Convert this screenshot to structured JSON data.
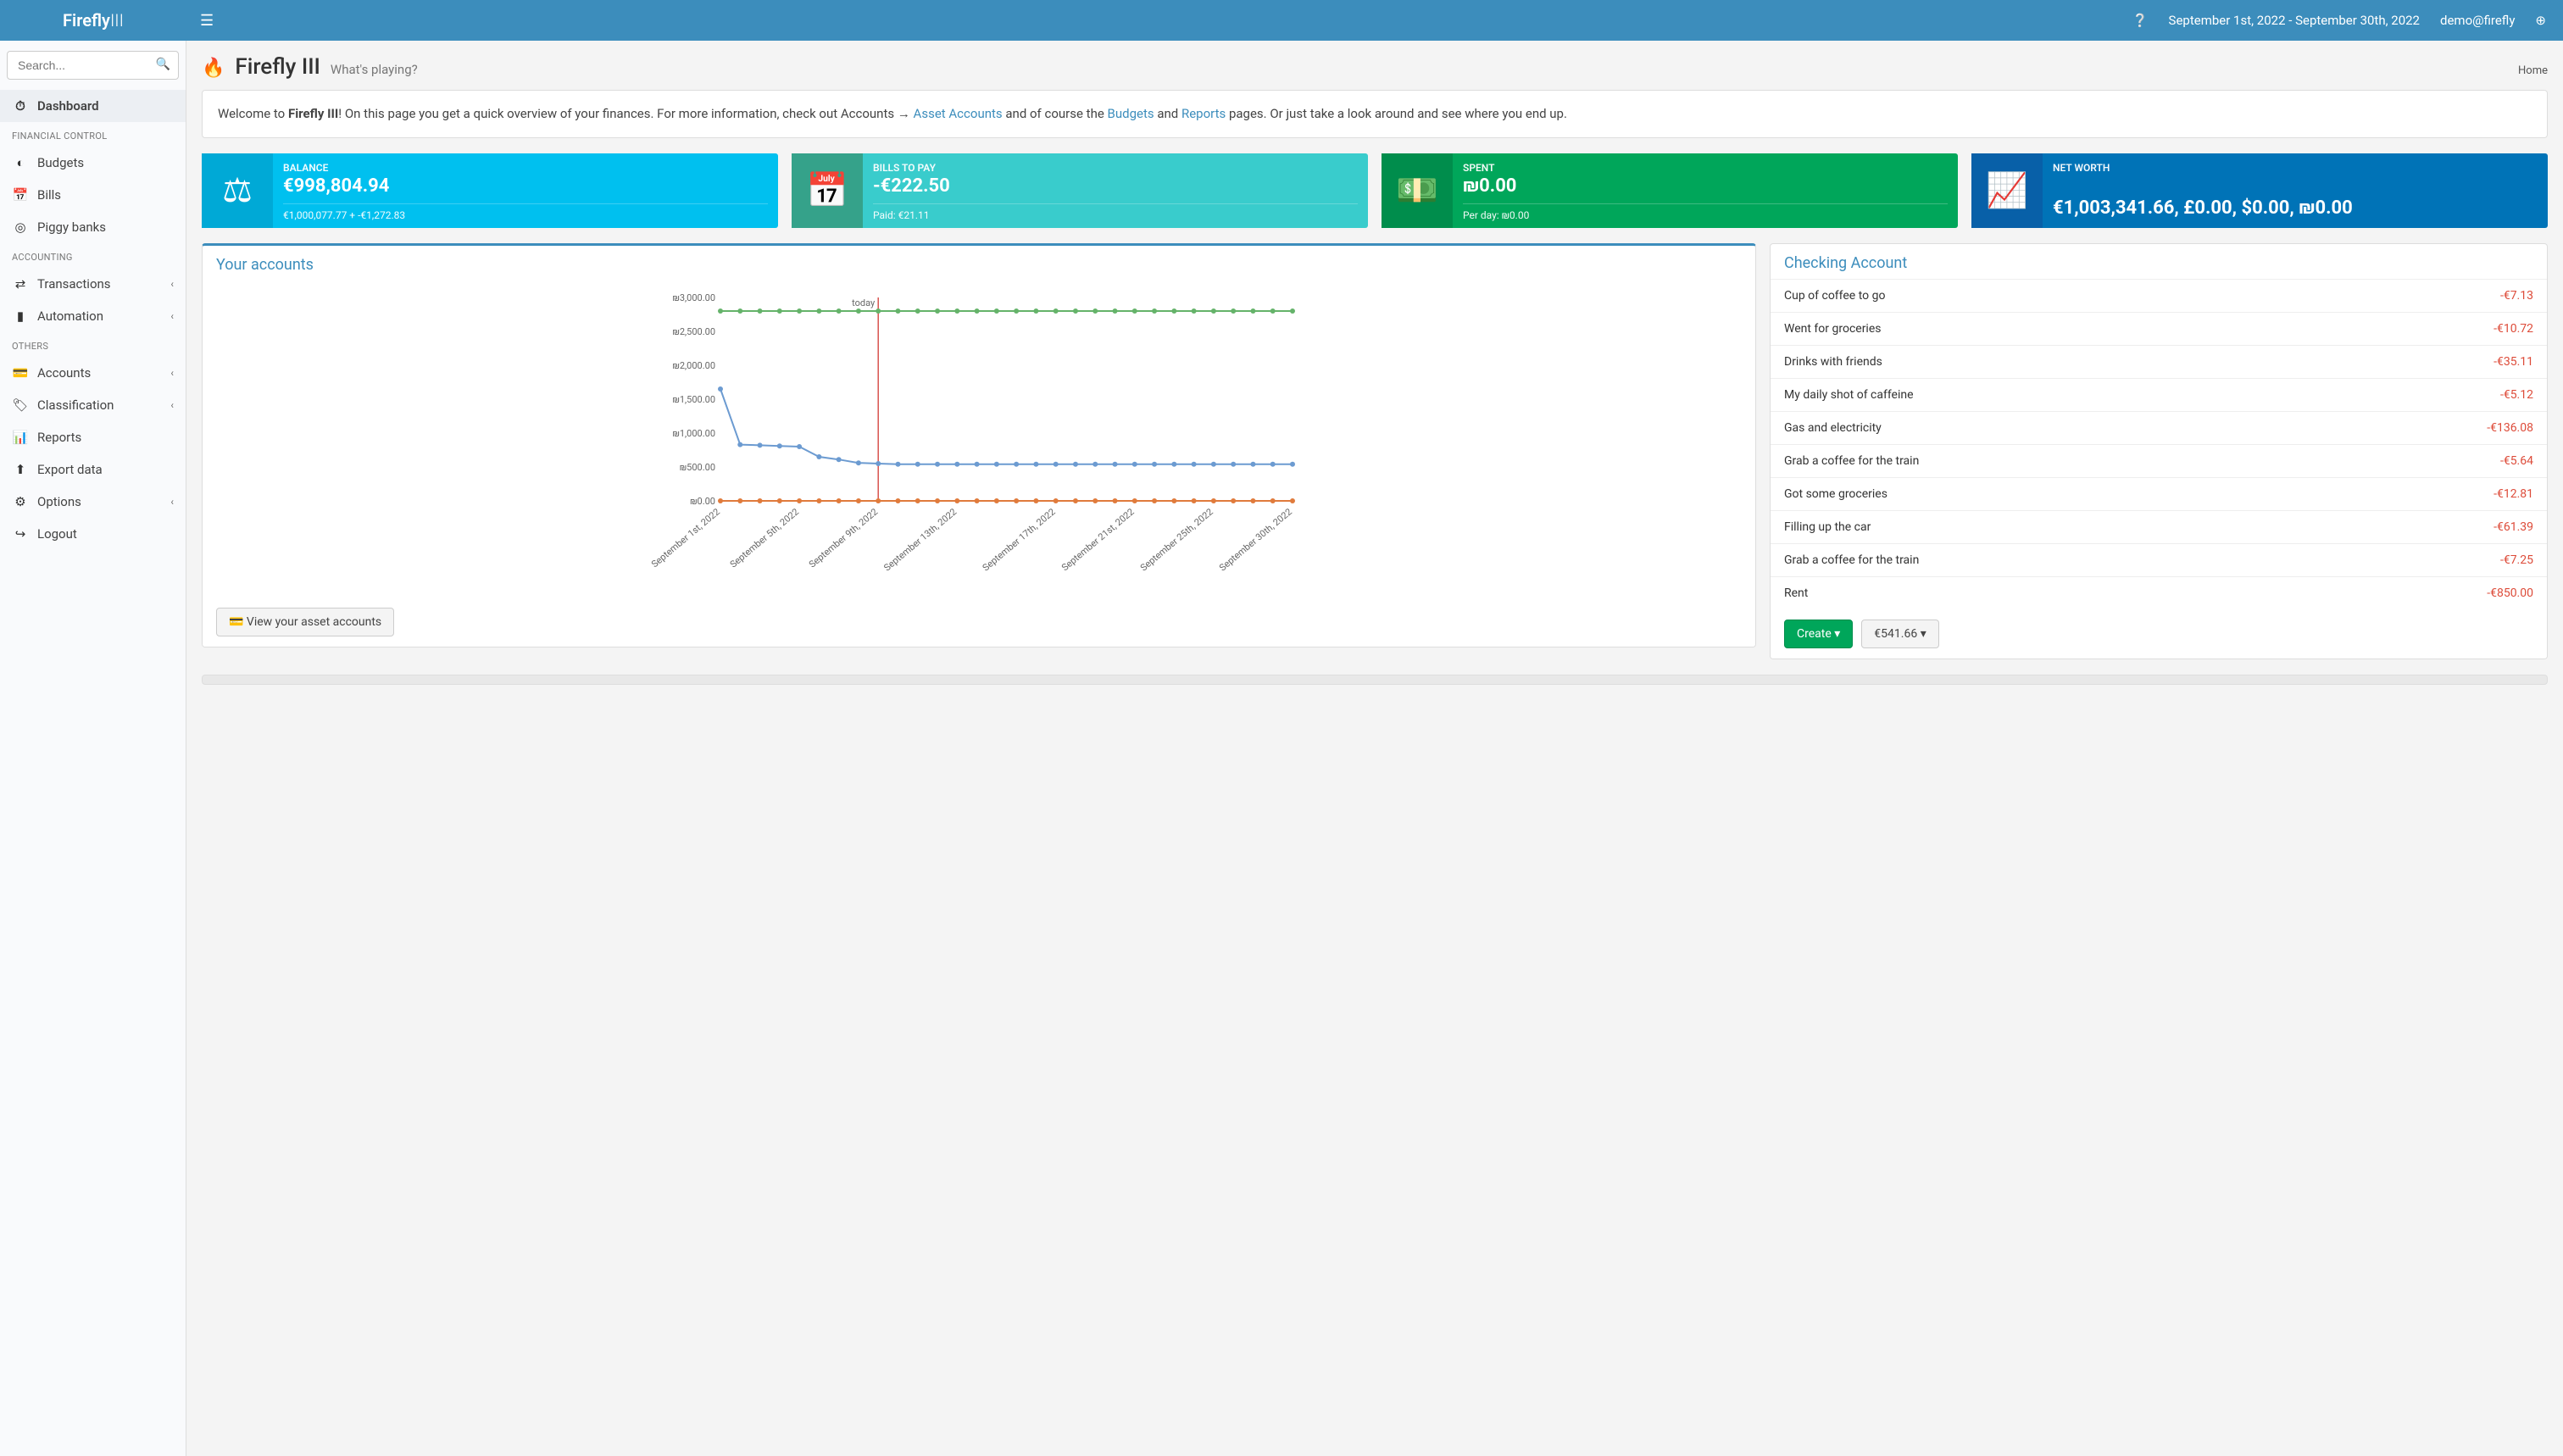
{
  "app": {
    "logo_bold": "Firefly",
    "logo_thin": "III"
  },
  "topbar": {
    "date_range": "September 1st, 2022 - September 30th, 2022",
    "user": "demo@firefly"
  },
  "search": {
    "placeholder": "Search..."
  },
  "sidebar": {
    "sections": [
      {
        "label": "",
        "items": [
          {
            "icon": "⏱",
            "label": "Dashboard",
            "active": true
          }
        ]
      },
      {
        "label": "FINANCIAL CONTROL",
        "items": [
          {
            "icon": "◐",
            "label": "Budgets"
          },
          {
            "icon": "📅",
            "label": "Bills"
          },
          {
            "icon": "◎",
            "label": "Piggy banks"
          }
        ]
      },
      {
        "label": "ACCOUNTING",
        "items": [
          {
            "icon": "⇄",
            "label": "Transactions",
            "expandable": true
          },
          {
            "icon": "▮",
            "label": "Automation",
            "expandable": true
          }
        ]
      },
      {
        "label": "OTHERS",
        "items": [
          {
            "icon": "💳",
            "label": "Accounts",
            "expandable": true
          },
          {
            "icon": "🏷",
            "label": "Classification",
            "expandable": true
          },
          {
            "icon": "📊",
            "label": "Reports"
          },
          {
            "icon": "⬆",
            "label": "Export data"
          },
          {
            "icon": "⚙",
            "label": "Options",
            "expandable": true
          },
          {
            "icon": "↪",
            "label": "Logout"
          }
        ]
      }
    ]
  },
  "page": {
    "title": "Firefly III",
    "subtitle": "What's playing?",
    "breadcrumb": "Home",
    "welcome": {
      "prefix": "Welcome to ",
      "bold": "Firefly III",
      "mid1": "! On this page you get a quick overview of your finances. For more information, check out Accounts → ",
      "link1": "Asset Accounts",
      "mid2": " and of course the ",
      "link2": "Budgets",
      "mid3": " and ",
      "link3": "Reports",
      "suffix": " pages. Or just take a look around and see where you end up."
    }
  },
  "info_boxes": {
    "balance": {
      "label": "BALANCE",
      "value": "€998,804.94",
      "foot": "€1,000,077.77 + -€1,272.83"
    },
    "bills": {
      "label": "BILLS TO PAY",
      "value": "-€222.50",
      "foot": "Paid: €21.11"
    },
    "spent": {
      "label": "SPENT",
      "value": "₪0.00",
      "foot": "Per day: ₪0.00"
    },
    "networth": {
      "label": "NET WORTH",
      "value": "€1,003,341.66, £0.00, $0.00, ₪0.00",
      "foot": ""
    }
  },
  "accounts_panel": {
    "title": "Your accounts",
    "view_btn": "View your asset accounts"
  },
  "checking_panel": {
    "title": "Checking Account",
    "transactions": [
      {
        "label": "Cup of coffee to go",
        "amount": "-€7.13"
      },
      {
        "label": "Went for groceries",
        "amount": "-€10.72"
      },
      {
        "label": "Drinks with friends",
        "amount": "-€35.11"
      },
      {
        "label": "My daily shot of caffeine",
        "amount": "-€5.12"
      },
      {
        "label": "Gas and electricity",
        "amount": "-€136.08"
      },
      {
        "label": "Grab a coffee for the train",
        "amount": "-€5.64"
      },
      {
        "label": "Got some groceries",
        "amount": "-€12.81"
      },
      {
        "label": "Filling up the car",
        "amount": "-€61.39"
      },
      {
        "label": "Grab a coffee for the train",
        "amount": "-€7.25"
      },
      {
        "label": "Rent",
        "amount": "-€850.00"
      }
    ],
    "create_btn": "Create",
    "balance_btn": "€541.66"
  },
  "chart_data": {
    "type": "line",
    "title": "Your accounts",
    "ylabel": "",
    "yticks": [
      "₪0.00",
      "₪500.00",
      "₪1,000.00",
      "₪1,500.00",
      "₪2,000.00",
      "₪2,500.00",
      "₪3,000.00"
    ],
    "ylim": [
      0,
      3000
    ],
    "xticks": [
      "September 1st, 2022",
      "September 5th, 2022",
      "September 9th, 2022",
      "September 13th, 2022",
      "September 17th, 2022",
      "September 21st, 2022",
      "September 25th, 2022",
      "September 30th, 2022"
    ],
    "today_index": 8,
    "today_label": "today",
    "x": [
      0,
      1,
      2,
      3,
      4,
      5,
      6,
      7,
      8,
      9,
      10,
      11,
      12,
      13,
      14,
      15,
      16,
      17,
      18,
      19,
      20,
      21,
      22,
      23,
      24,
      25,
      26,
      27,
      28,
      29
    ],
    "series": [
      {
        "name": "green",
        "color": "#65b36a",
        "values": [
          2800,
          2800,
          2800,
          2800,
          2800,
          2800,
          2800,
          2800,
          2800,
          2800,
          2800,
          2800,
          2800,
          2800,
          2800,
          2800,
          2800,
          2800,
          2800,
          2800,
          2800,
          2800,
          2800,
          2800,
          2800,
          2800,
          2800,
          2800,
          2800,
          2800
        ]
      },
      {
        "name": "blue",
        "color": "#6c9bd1",
        "values": [
          1650,
          830,
          820,
          810,
          800,
          650,
          610,
          560,
          550,
          540,
          540,
          540,
          540,
          540,
          540,
          540,
          540,
          540,
          540,
          540,
          540,
          540,
          540,
          540,
          540,
          540,
          540,
          540,
          540,
          540
        ]
      },
      {
        "name": "orange",
        "color": "#e07b3c",
        "values": [
          0,
          0,
          0,
          0,
          0,
          0,
          0,
          0,
          0,
          0,
          0,
          0,
          0,
          0,
          0,
          0,
          0,
          0,
          0,
          0,
          0,
          0,
          0,
          0,
          0,
          0,
          0,
          0,
          0,
          0
        ]
      }
    ]
  }
}
